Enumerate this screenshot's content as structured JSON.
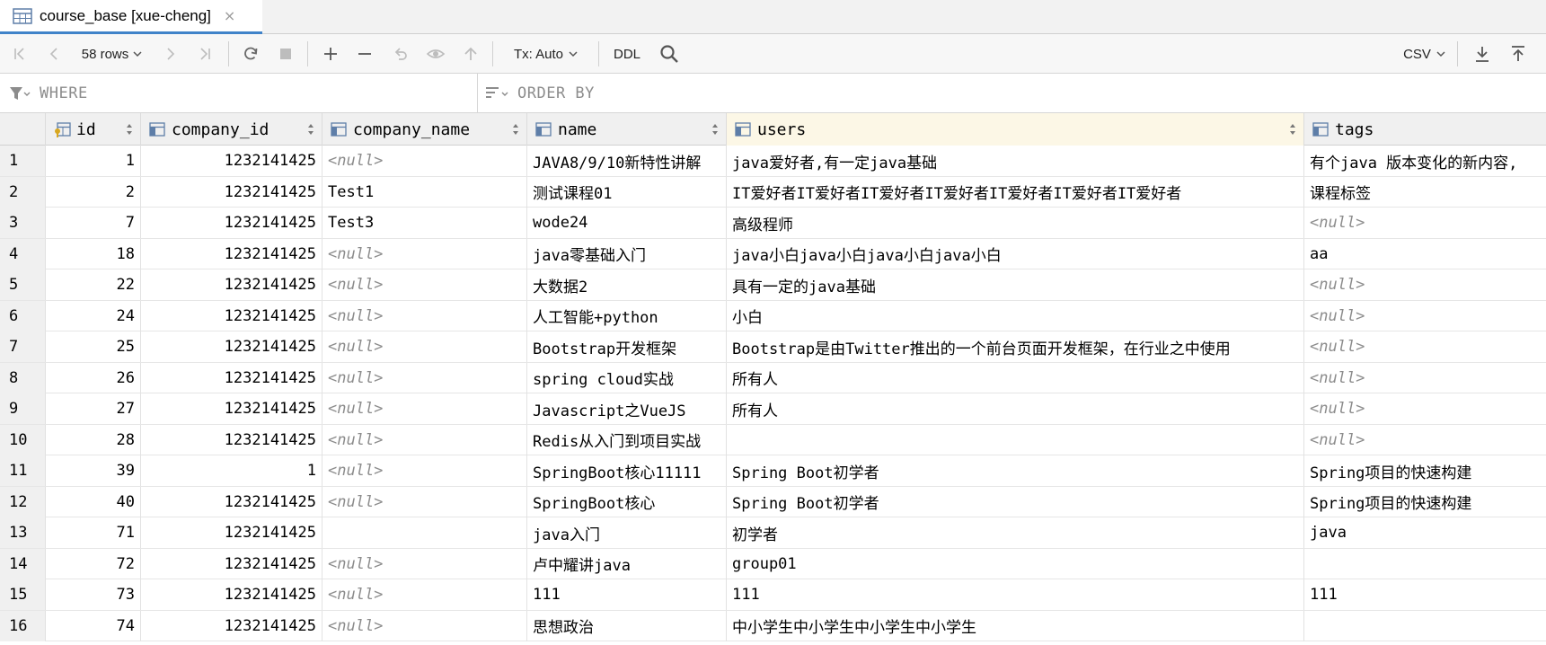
{
  "tab": {
    "title": "course_base [xue-cheng]",
    "close": "×",
    "accent": "#4083c9"
  },
  "toolbar": {
    "rows_label": "58 rows",
    "tx_label": "Tx: Auto",
    "ddl_label": "DDL",
    "export_label": "CSV"
  },
  "filters": {
    "where": "WHERE",
    "order_by": "ORDER BY"
  },
  "columns": [
    {
      "name": "id",
      "key": true
    },
    {
      "name": "company_id"
    },
    {
      "name": "company_name"
    },
    {
      "name": "name"
    },
    {
      "name": "users",
      "active": true
    },
    {
      "name": "tags"
    }
  ],
  "null_text": "<null>",
  "rows": [
    {
      "rn": "1",
      "id": "1",
      "company_id": "1232141425",
      "company_name": "<null>",
      "name": "JAVA8/9/10新特性讲解",
      "users": "java爱好者,有一定java基础",
      "tags": "有个java 版本变化的新内容,"
    },
    {
      "rn": "2",
      "id": "2",
      "company_id": "1232141425",
      "company_name": "Test1",
      "name": "测试课程01",
      "users": "IT爱好者IT爱好者IT爱好者IT爱好者IT爱好者IT爱好者IT爱好者",
      "tags": "课程标签"
    },
    {
      "rn": "3",
      "id": "7",
      "company_id": "1232141425",
      "company_name": "Test3",
      "name": "wode24",
      "users": "高级程师",
      "tags": "<null>"
    },
    {
      "rn": "4",
      "id": "18",
      "company_id": "1232141425",
      "company_name": "<null>",
      "name": "java零基础入门",
      "users": "java小白java小白java小白java小白",
      "tags": "aa"
    },
    {
      "rn": "5",
      "id": "22",
      "company_id": "1232141425",
      "company_name": "<null>",
      "name": "大数据2",
      "users": "具有一定的java基础",
      "tags": "<null>"
    },
    {
      "rn": "6",
      "id": "24",
      "company_id": "1232141425",
      "company_name": "<null>",
      "name": "人工智能+python",
      "users": "小白",
      "tags": "<null>"
    },
    {
      "rn": "7",
      "id": "25",
      "company_id": "1232141425",
      "company_name": "<null>",
      "name": "Bootstrap开发框架",
      "users": "Bootstrap是由Twitter推出的一个前台页面开发框架，在行业之中使用",
      "tags": "<null>"
    },
    {
      "rn": "8",
      "id": "26",
      "company_id": "1232141425",
      "company_name": "<null>",
      "name": "spring cloud实战",
      "users": "所有人",
      "tags": "<null>"
    },
    {
      "rn": "9",
      "id": "27",
      "company_id": "1232141425",
      "company_name": "<null>",
      "name": "Javascript之VueJS",
      "users": "所有人",
      "tags": "<null>"
    },
    {
      "rn": "10",
      "id": "28",
      "company_id": "1232141425",
      "company_name": "<null>",
      "name": "Redis从入门到项目实战",
      "users": "",
      "tags": "<null>"
    },
    {
      "rn": "11",
      "id": "39",
      "company_id": "1",
      "company_name": "<null>",
      "name": "SpringBoot核心11111",
      "users": "Spring Boot初学者",
      "tags": "Spring项目的快速构建"
    },
    {
      "rn": "12",
      "id": "40",
      "company_id": "1232141425",
      "company_name": "<null>",
      "name": "SpringBoot核心",
      "users": "Spring Boot初学者",
      "tags": "Spring项目的快速构建"
    },
    {
      "rn": "13",
      "id": "71",
      "company_id": "1232141425",
      "company_name": "",
      "name": "java入门",
      "users": "初学者",
      "tags": "java"
    },
    {
      "rn": "14",
      "id": "72",
      "company_id": "1232141425",
      "company_name": "<null>",
      "name": "卢中耀讲java",
      "users": "group01",
      "tags": ""
    },
    {
      "rn": "15",
      "id": "73",
      "company_id": "1232141425",
      "company_name": "<null>",
      "name": "111",
      "users": "111",
      "tags": "111"
    },
    {
      "rn": "16",
      "id": "74",
      "company_id": "1232141425",
      "company_name": "<null>",
      "name": "思想政治",
      "users": "中小学生中小学生中小学生中小学生",
      "tags": ""
    }
  ]
}
